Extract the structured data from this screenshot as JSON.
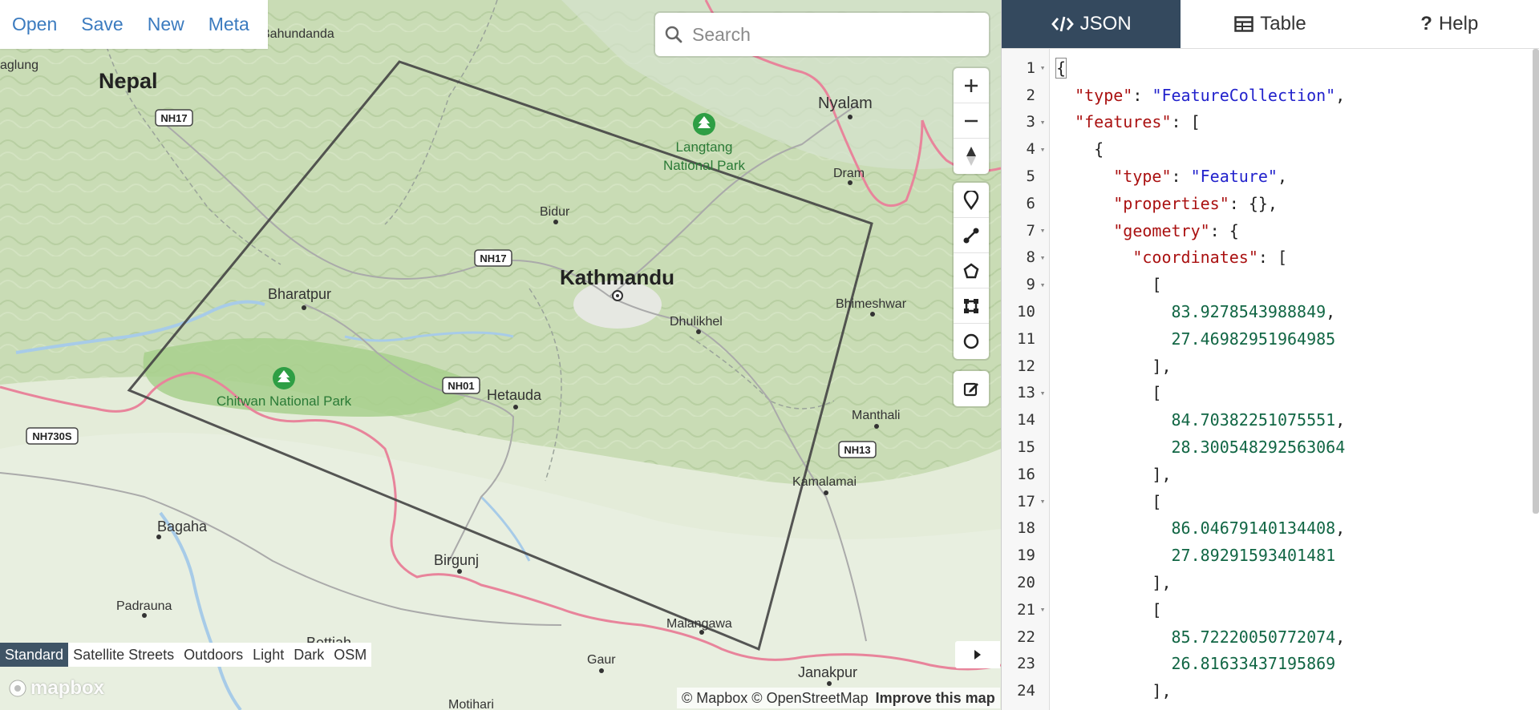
{
  "menu": {
    "items": [
      "Open",
      "Save",
      "New",
      "Meta"
    ]
  },
  "search": {
    "placeholder": "Search",
    "value": ""
  },
  "map_labels": {
    "nepal": "Nepal",
    "bahundanda": "Bahundanda",
    "aglung": "aglung",
    "nh17_a": "NH17",
    "nh17_b": "NH17",
    "nh01": "NH01",
    "nh13": "NH13",
    "nh730s": "NH730S",
    "nyalam": "Nyalam",
    "langtang": [
      "Langtang",
      "National Park"
    ],
    "dram": "Dram",
    "bidur": "Bidur",
    "kathmandu": "Kathmandu",
    "bharatpur": "Bharatpur",
    "bhimeshwar": "Bhimeshwar",
    "dhulikhel": "Dhulikhel",
    "chitwan": "Chitwan National Park",
    "hetauda": "Hetauda",
    "manthali": "Manthali",
    "kamalamai": "Kamalamai",
    "bagaha": "Bagaha",
    "birgunj": "Birgunj",
    "padrauna": "Padrauna",
    "bettiah": "Bettiah",
    "malangawa": "Malangawa",
    "gaur": "Gaur",
    "janakpur": "Janakpur",
    "motihari": "Motihari"
  },
  "map_controls": {
    "zoom": [
      "plus-icon",
      "minus-icon",
      "compass-icon"
    ],
    "draw": [
      "marker-icon",
      "line-icon",
      "polygon-icon",
      "rectangle-icon",
      "circle-icon"
    ],
    "edit": [
      "edit-icon"
    ]
  },
  "styles": {
    "options": [
      "Standard",
      "Satellite Streets",
      "Outdoors",
      "Light",
      "Dark",
      "OSM"
    ],
    "active": "Standard"
  },
  "logo": "mapbox",
  "attribution": {
    "text": "© Mapbox © OpenStreetMap",
    "improve": "Improve this map"
  },
  "tabs": [
    {
      "label": "JSON",
      "icon": "code-icon",
      "active": true
    },
    {
      "label": "Table",
      "icon": "table-icon",
      "active": false
    },
    {
      "label": "Help",
      "icon": "help-icon",
      "active": false
    }
  ],
  "editor": {
    "lines": [
      {
        "n": "1",
        "fold": true,
        "html": "<span class=\"cursor-box\">{</span>"
      },
      {
        "n": "2",
        "fold": false,
        "html": "  <span class=\"k\">\"type\"</span>: <span class=\"str\">\"FeatureCollection\"</span>,"
      },
      {
        "n": "3",
        "fold": true,
        "html": "  <span class=\"k\">\"features\"</span>: ["
      },
      {
        "n": "4",
        "fold": true,
        "html": "    {"
      },
      {
        "n": "5",
        "fold": false,
        "html": "      <span class=\"k\">\"type\"</span>: <span class=\"str\">\"Feature\"</span>,"
      },
      {
        "n": "6",
        "fold": false,
        "html": "      <span class=\"k\">\"properties\"</span>: {},"
      },
      {
        "n": "7",
        "fold": true,
        "html": "      <span class=\"k\">\"geometry\"</span>: {"
      },
      {
        "n": "8",
        "fold": true,
        "html": "        <span class=\"k\">\"coordinates\"</span>: ["
      },
      {
        "n": "9",
        "fold": true,
        "html": "          ["
      },
      {
        "n": "10",
        "fold": false,
        "html": "            <span class=\"num\">83.9278543988849</span>,"
      },
      {
        "n": "11",
        "fold": false,
        "html": "            <span class=\"num\">27.46982951964985</span>"
      },
      {
        "n": "12",
        "fold": false,
        "html": "          ],"
      },
      {
        "n": "13",
        "fold": true,
        "html": "          ["
      },
      {
        "n": "14",
        "fold": false,
        "html": "            <span class=\"num\">84.70382251075551</span>,"
      },
      {
        "n": "15",
        "fold": false,
        "html": "            <span class=\"num\">28.300548292563064</span>"
      },
      {
        "n": "16",
        "fold": false,
        "html": "          ],"
      },
      {
        "n": "17",
        "fold": true,
        "html": "          ["
      },
      {
        "n": "18",
        "fold": false,
        "html": "            <span class=\"num\">86.04679140134408</span>,"
      },
      {
        "n": "19",
        "fold": false,
        "html": "            <span class=\"num\">27.89291593401481</span>"
      },
      {
        "n": "20",
        "fold": false,
        "html": "          ],"
      },
      {
        "n": "21",
        "fold": true,
        "html": "          ["
      },
      {
        "n": "22",
        "fold": false,
        "html": "            <span class=\"num\">85.72220050772074</span>,"
      },
      {
        "n": "23",
        "fold": false,
        "html": "            <span class=\"num\">26.81633437195869</span>"
      },
      {
        "n": "24",
        "fold": false,
        "html": "          ],"
      }
    ]
  },
  "colors": {
    "accent_link": "#3b7bbf",
    "tab_active_bg": "#34495e",
    "json_key": "#a11",
    "json_string": "#2222cc",
    "json_number": "#116644",
    "polygon_stroke": "#444444"
  }
}
